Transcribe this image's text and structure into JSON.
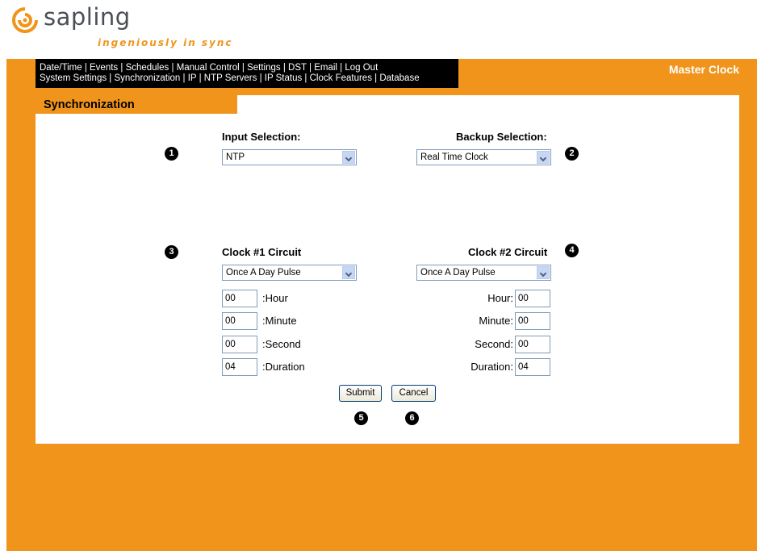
{
  "brand": {
    "name": "sapling",
    "tagline": "ingeniously in sync"
  },
  "nav": {
    "row1": [
      "Date/Time",
      "Events",
      "Schedules",
      "Manual Control",
      "Settings",
      "DST",
      "Email",
      "Log Out"
    ],
    "row2": [
      "System Settings",
      "Synchronization",
      "IP",
      "NTP Servers",
      "IP Status",
      "Clock Features",
      "Database"
    ],
    "separator": " | "
  },
  "header": {
    "master_label": "Master Clock",
    "section_title": "Synchronization"
  },
  "input_selection": {
    "label": "Input Selection:",
    "value": "NTP",
    "marker": "1"
  },
  "backup_selection": {
    "label": "Backup Selection:",
    "value": "Real Time Clock",
    "marker": "2"
  },
  "clock1": {
    "label": "Clock #1 Circuit",
    "marker": "3",
    "mode": "Once A Day Pulse",
    "hour": "00",
    "minute": "00",
    "second": "00",
    "duration": "04",
    "hour_label": ":Hour",
    "minute_label": ":Minute",
    "second_label": ":Second",
    "duration_label": ":Duration"
  },
  "clock2": {
    "label": "Clock #2 Circuit",
    "marker": "4",
    "mode": "Once A Day Pulse",
    "hour": "00",
    "minute": "00",
    "second": "00",
    "duration": "04",
    "hour_label": "Hour:",
    "minute_label": "Minute:",
    "second_label": "Second:",
    "duration_label": "Duration:"
  },
  "actions": {
    "submit_label": "Submit",
    "cancel_label": "Cancel",
    "submit_marker": "5",
    "cancel_marker": "6"
  },
  "colors": {
    "brand_orange": "#f0941b",
    "nav_bg": "#000000"
  }
}
